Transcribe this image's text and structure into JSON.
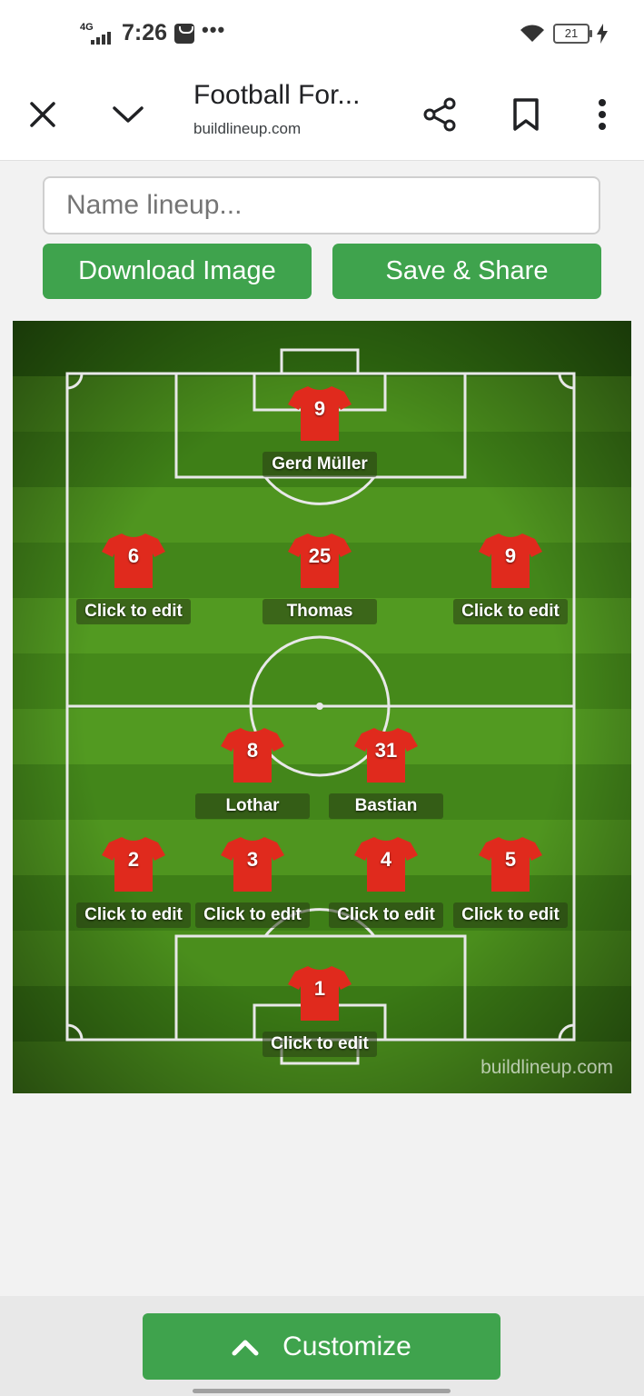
{
  "status_bar": {
    "network": "4G",
    "time": "7:26",
    "battery": "21"
  },
  "browser": {
    "title": "Football For...",
    "url": "buildlineup.com",
    "icons": [
      "close-icon",
      "chevron-down-icon",
      "share-icon",
      "bookmark-icon",
      "more-vert-icon"
    ]
  },
  "controls": {
    "name_placeholder": "Name lineup...",
    "download_label": "Download Image",
    "save_label": "Save & Share"
  },
  "pitch": {
    "watermark": "buildlineup.com",
    "shirt_color": "#e02a1d",
    "players": [
      {
        "number": "9",
        "name": "Gerd Müller"
      },
      {
        "number": "6",
        "name": "Click to edit"
      },
      {
        "number": "25",
        "name": "Thomas"
      },
      {
        "number": "9",
        "name": "Click to edit"
      },
      {
        "number": "8",
        "name": "Lothar"
      },
      {
        "number": "31",
        "name": "Bastian"
      },
      {
        "number": "2",
        "name": "Click to edit"
      },
      {
        "number": "3",
        "name": "Click to edit"
      },
      {
        "number": "4",
        "name": "Click to edit"
      },
      {
        "number": "5",
        "name": "Click to edit"
      },
      {
        "number": "1",
        "name": "Click to edit"
      }
    ]
  },
  "bottom": {
    "customize_label": "Customize",
    "accent": "#3fa34d"
  }
}
